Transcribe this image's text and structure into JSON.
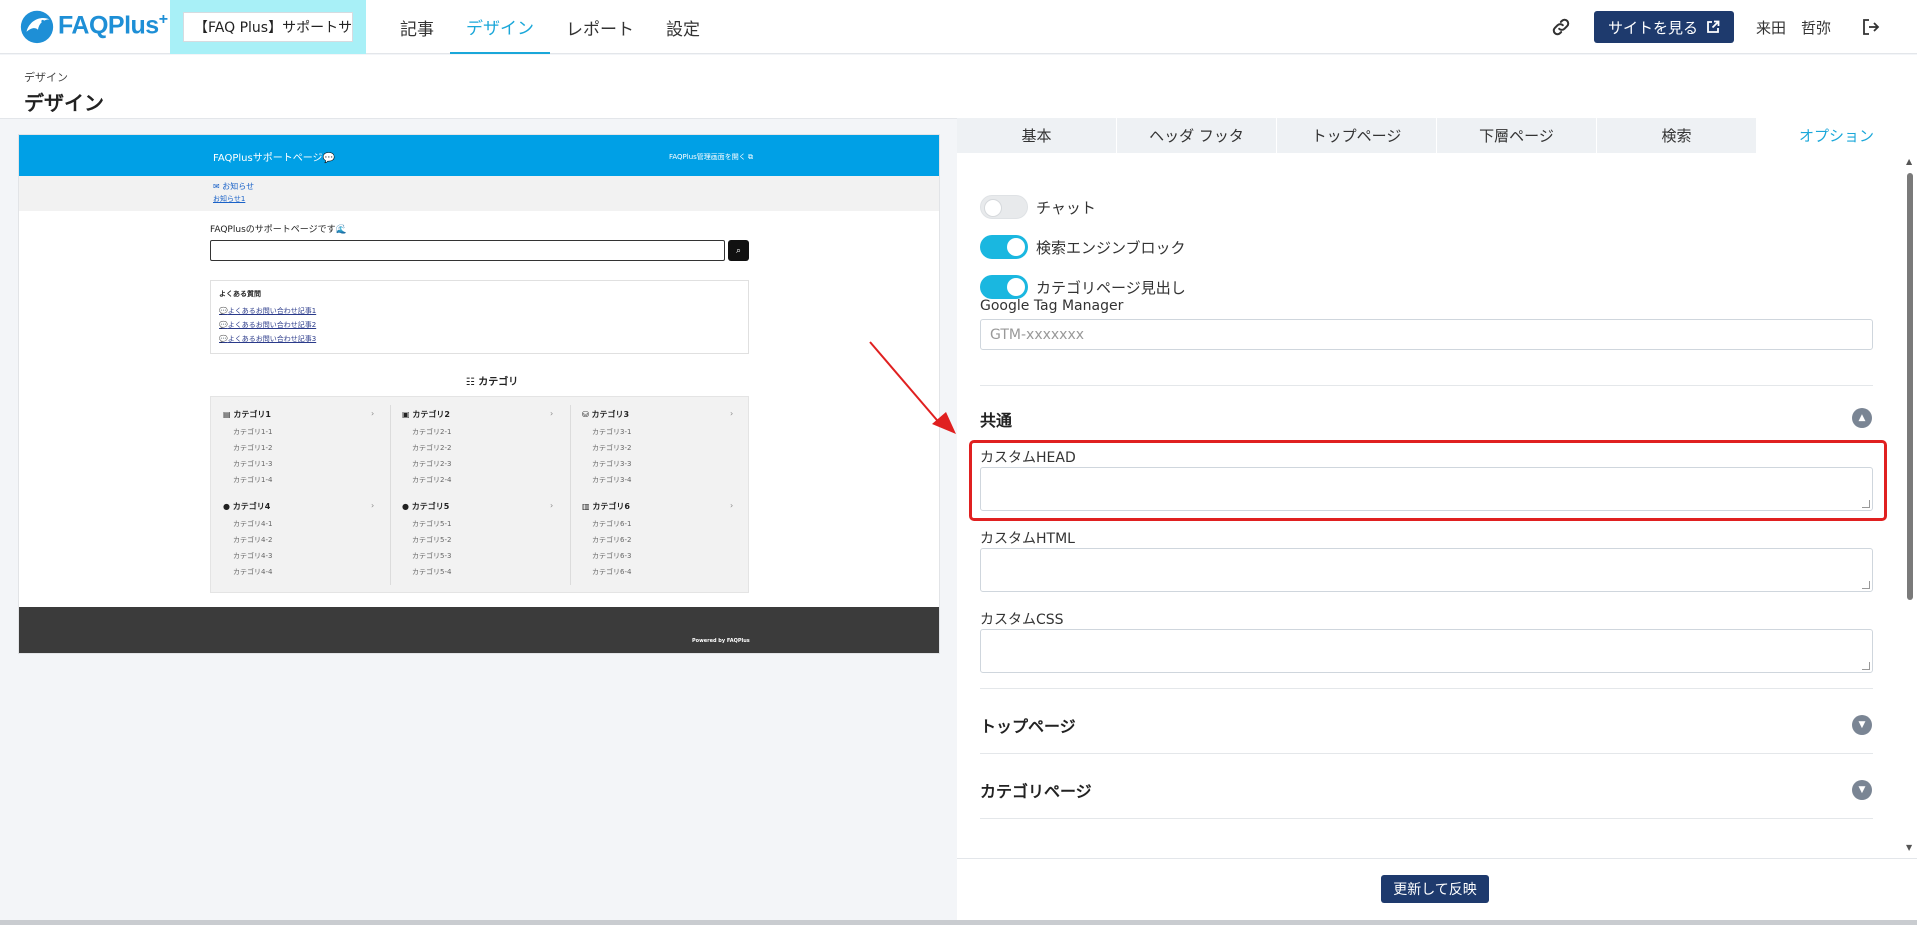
{
  "header": {
    "logo_text": "FAQPlus",
    "logo_plus": "+",
    "site_selector_value": "【FAQ Plus】サポートサ",
    "nav": [
      {
        "label": "記事"
      },
      {
        "label": "デザイン"
      },
      {
        "label": "レポート"
      },
      {
        "label": "設定"
      }
    ],
    "view_site_label": "サイトを見る",
    "user_name": "来田　哲弥"
  },
  "page": {
    "breadcrumb": "デザイン",
    "title": "デザイン"
  },
  "preview": {
    "site_title": "FAQPlusサポートページ💬",
    "admin_link": "FAQPlus管理画面を開く",
    "notice_title": "お知らせ",
    "notice_item": "お知らせ1",
    "welcome": "FAQPlusのサポートページです🌊",
    "faq_title": "よくある質問",
    "faq_items": [
      "よくあるお問い合わせ記事1",
      "よくあるお問い合わせ記事2",
      "よくあるお問い合わせ記事3"
    ],
    "category_heading": "カテゴリ",
    "categories": [
      {
        "icon": "▤",
        "name": "カテゴリ1",
        "subs": [
          "カテゴリ1-1",
          "カテゴリ1-2",
          "カテゴリ1-3",
          "カテゴリ1-4"
        ]
      },
      {
        "icon": "▣",
        "name": "カテゴリ2",
        "subs": [
          "カテゴリ2-1",
          "カテゴリ2-2",
          "カテゴリ2-3",
          "カテゴリ2-4"
        ]
      },
      {
        "icon": "⛁",
        "name": "カテゴリ3",
        "subs": [
          "カテゴリ3-1",
          "カテゴリ3-2",
          "カテゴリ3-3",
          "カテゴリ3-4"
        ]
      },
      {
        "icon": "●",
        "name": "カテゴリ4",
        "subs": [
          "カテゴリ4-1",
          "カテゴリ4-2",
          "カテゴリ4-3",
          "カテゴリ4-4"
        ]
      },
      {
        "icon": "●",
        "name": "カテゴリ5",
        "subs": [
          "カテゴリ5-1",
          "カテゴリ5-2",
          "カテゴリ5-3",
          "カテゴリ5-4"
        ]
      },
      {
        "icon": "▥",
        "name": "カテゴリ6",
        "subs": [
          "カテゴリ6-1",
          "カテゴリ6-2",
          "カテゴリ6-3",
          "カテゴリ6-4"
        ]
      }
    ],
    "chevron": "›",
    "footer_text": "Powered by FAQPlus"
  },
  "panel": {
    "tabs": [
      {
        "label": "基本",
        "active": false
      },
      {
        "label": "ヘッダ フッタ",
        "active": false
      },
      {
        "label": "トップページ",
        "active": false
      },
      {
        "label": "下層ページ",
        "active": false
      },
      {
        "label": "検索",
        "active": false
      },
      {
        "label": "オプション",
        "active": true
      }
    ],
    "toggles": [
      {
        "label": "チャット",
        "on": false
      },
      {
        "label": "検索エンジンブロック",
        "on": true
      },
      {
        "label": "カテゴリページ見出し",
        "on": true
      }
    ],
    "gtm_label": "Google Tag Manager",
    "gtm_placeholder": "GTM-xxxxxxx",
    "common_section": "共通",
    "custom_head_label": "カスタムHEAD",
    "custom_html_label": "カスタムHTML",
    "custom_css_label": "カスタムCSS",
    "top_page_section": "トップページ",
    "category_page_section": "カテゴリページ",
    "update_label": "更新して反映"
  },
  "colors": {
    "accent": "#1aa7d9",
    "primary_button": "#1e3a6d",
    "highlight": "#e02020",
    "preview_header": "#00a0e6"
  }
}
